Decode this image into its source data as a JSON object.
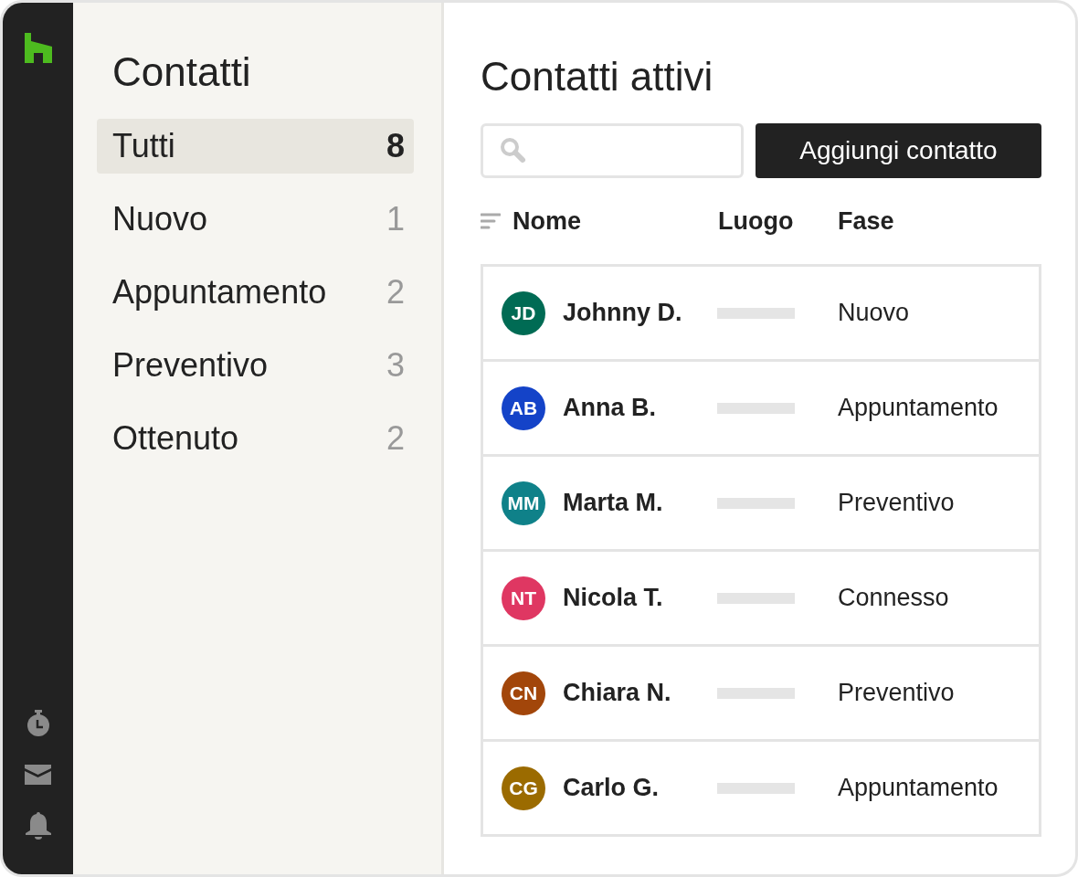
{
  "sidebar": {
    "title": "Contatti",
    "items": [
      {
        "label": "Tutti",
        "count": "8",
        "selected": true
      },
      {
        "label": "Nuovo",
        "count": "1",
        "selected": false
      },
      {
        "label": "Appuntamento",
        "count": "2",
        "selected": false
      },
      {
        "label": "Preventivo",
        "count": "3",
        "selected": false
      },
      {
        "label": "Ottenuto",
        "count": "2",
        "selected": false
      }
    ]
  },
  "main": {
    "title": "Contatti attivi",
    "add_button": "Aggiungi contatto",
    "table": {
      "columns": [
        "Nome",
        "Luogo",
        "Fase"
      ],
      "rows": [
        {
          "initials": "JD",
          "name": "Johnny D.",
          "color": "#006b54",
          "phase": "Nuovo"
        },
        {
          "initials": "AB",
          "name": "Anna B.",
          "color": "#1443c8",
          "phase": "Appuntamento"
        },
        {
          "initials": "MM",
          "name": "Marta M.",
          "color": "#0f8189",
          "phase": "Preventivo"
        },
        {
          "initials": "NT",
          "name": "Nicola T.",
          "color": "#df3762",
          "phase": "Connesso"
        },
        {
          "initials": "CN",
          "name": "Chiara N.",
          "color": "#a2460a",
          "phase": "Preventivo"
        },
        {
          "initials": "CG",
          "name": "Carlo G.",
          "color": "#9b6b00",
          "phase": "Appuntamento"
        }
      ]
    }
  }
}
